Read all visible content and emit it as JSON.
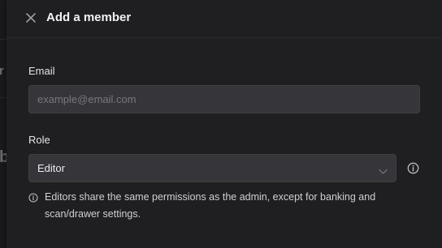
{
  "dialog": {
    "title": "Add a member",
    "close_icon": "close-icon"
  },
  "form": {
    "email": {
      "label": "Email",
      "value": "",
      "placeholder": "example@email.com"
    },
    "role": {
      "label": "Role",
      "selected": "Editor",
      "dropdown_icon": "chevron-down-icon",
      "info_icon": "info-icon"
    },
    "hint": {
      "icon": "info-icon",
      "text": "Editors share the same permissions as the admin, except for banking and scan/drawer settings."
    }
  },
  "colors": {
    "panel_background": "#1f1f22",
    "input_background": "#36363a",
    "text_primary": "#f2f2f4",
    "text_muted": "#77777d"
  }
}
